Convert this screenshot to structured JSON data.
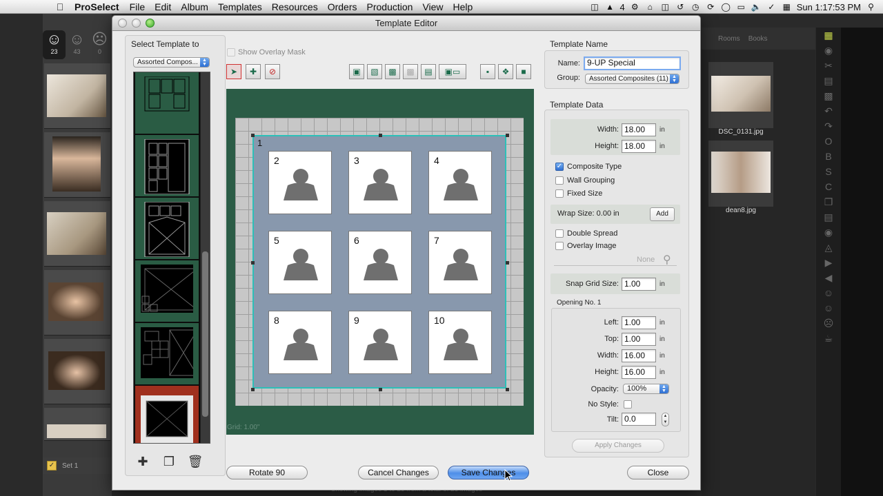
{
  "menubar": {
    "app": "ProSelect",
    "items": [
      "File",
      "Edit",
      "Album",
      "Templates",
      "Resources",
      "Orders",
      "Production",
      "View",
      "Help"
    ],
    "badge_count": "4",
    "clock": "Sun 1:17:53 PM"
  },
  "background": {
    "faces": [
      {
        "icon": "happy-face-icon",
        "count": "23"
      },
      {
        "icon": "neutral-face-icon",
        "count": "43"
      },
      {
        "icon": "sad-face-icon",
        "count": "0"
      }
    ],
    "set_label": "Set 1",
    "right_tabs": [
      "Rooms",
      "Books"
    ],
    "right_thumbs": [
      {
        "label": "DSC_0131.jpg"
      },
      {
        "label": "dean8.jpg"
      }
    ],
    "status": "Showing images 1 to 23 from a total of 23 images"
  },
  "dialog": {
    "title": "Template Editor",
    "left": {
      "heading": "Select Template to",
      "template_popup": "Assorted Compos...",
      "templates_count": 6
    },
    "center": {
      "overlay_mask_label": "Show Overlay Mask",
      "frame_number": "1",
      "openings": [
        "2",
        "3",
        "4",
        "5",
        "6",
        "7",
        "8",
        "9",
        "10"
      ],
      "grid_label": "Grid: 1.00\""
    },
    "right": {
      "template_name_heading": "Template Name",
      "name_label": "Name:",
      "name_value": "9-UP Special",
      "group_label": "Group:",
      "group_value": "Assorted Composites (11)",
      "template_data_heading": "Template Data",
      "width_label": "Width:",
      "width_value": "18.00",
      "height_label": "Height:",
      "height_value": "18.00",
      "unit": "in",
      "composite_type": "Composite Type",
      "wall_grouping": "Wall Grouping",
      "fixed_size": "Fixed Size",
      "wrap_size": "Wrap Size: 0.00 in",
      "add_button": "Add",
      "double_spread": "Double Spread",
      "overlay_image": "Overlay Image",
      "overlay_none": "None",
      "snap_label": "Snap Grid Size:",
      "snap_value": "1.00",
      "opening_heading": "Opening No. 1",
      "left_label": "Left:",
      "left_value": "1.00",
      "top_label": "Top:",
      "top_value": "1.00",
      "o_width_label": "Width:",
      "o_width_value": "16.00",
      "o_height_label": "Height:",
      "o_height_value": "16.00",
      "opacity_label": "Opacity:",
      "opacity_value": "100%",
      "no_style_label": "No Style:",
      "tilt_label": "Tilt:",
      "tilt_value": "0.0",
      "apply_button": "Apply Changes"
    },
    "buttons": {
      "rotate": "Rotate 90",
      "cancel": "Cancel Changes",
      "save": "Save Changes",
      "close": "Close"
    }
  },
  "colors": {
    "canvas_green": "#2b5c46",
    "frame_teal": "#2cc0b8",
    "frame_fill": "#8898ad",
    "selected_template": "#a0301e",
    "default_button": "#4e8ee8"
  }
}
